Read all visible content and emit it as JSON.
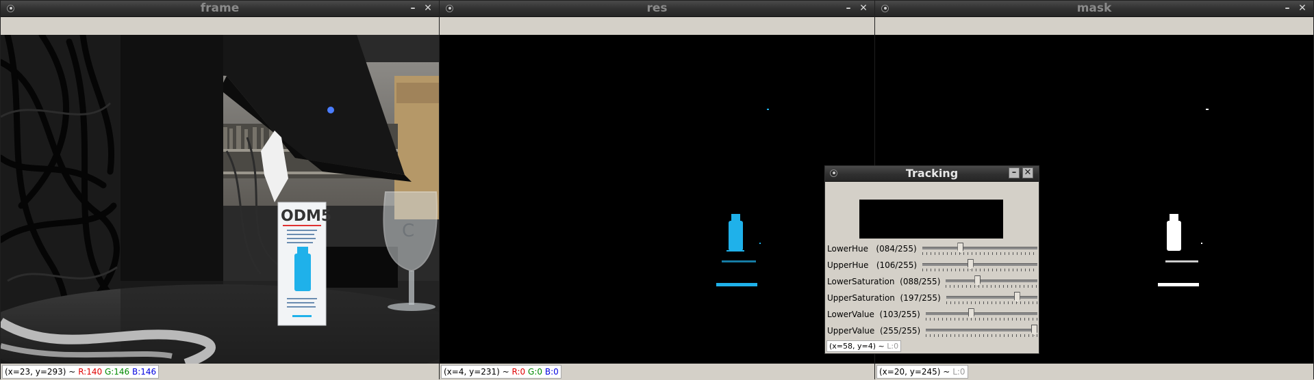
{
  "windows": [
    {
      "title": "frame",
      "status": {
        "coords": "(x=23, y=293) ~",
        "r": "R:140",
        "g": "G:146",
        "b": "B:146"
      }
    },
    {
      "title": "res",
      "status": {
        "coords": "(x=4, y=231) ~",
        "r": "R:0",
        "g": "G:0",
        "b": "B:0"
      }
    },
    {
      "title": "mask",
      "status": {
        "coords": "(x=20, y=245) ~",
        "l": "L:0"
      }
    }
  ],
  "controls": {
    "minimize": "–",
    "close": "✕"
  },
  "frame_scene": {
    "box_brand": "ODM5",
    "glass_text": "C",
    "accent_colors": {
      "bottle": "#1fb1ea",
      "box": "#f2f4f6",
      "desk": "#1d1d1d"
    }
  },
  "tracking": {
    "title": "Tracking",
    "trackbars": [
      {
        "label": "LowerHue",
        "value_text": "(084/255)",
        "value": 84,
        "max": 255
      },
      {
        "label": "UpperHue",
        "value_text": "(106/255)",
        "value": 106,
        "max": 255
      },
      {
        "label": "LowerSaturation",
        "value_text": "(088/255)",
        "value": 88,
        "max": 255
      },
      {
        "label": "UpperSaturation",
        "value_text": "(197/255)",
        "value": 197,
        "max": 255
      },
      {
        "label": "LowerValue",
        "value_text": "(103/255)",
        "value": 103,
        "max": 255
      },
      {
        "label": "UpperValue",
        "value_text": "(255/255)",
        "value": 255,
        "max": 255
      }
    ],
    "status": {
      "coords": "(x=58, y=4) ~",
      "l": "L:0"
    }
  }
}
